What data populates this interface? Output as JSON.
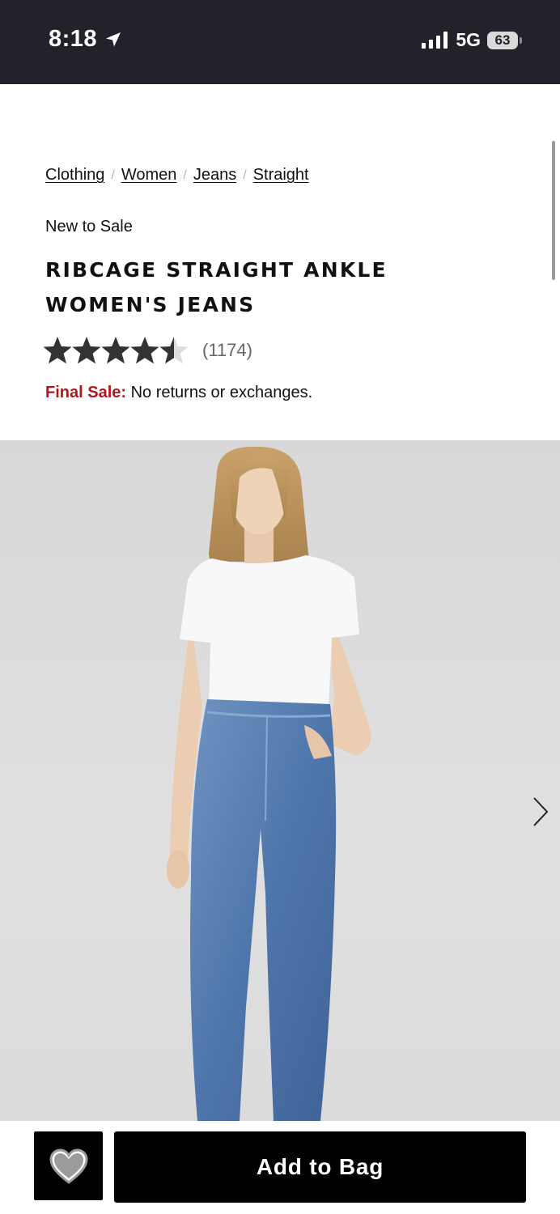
{
  "status_bar": {
    "time": "8:18",
    "network": "5G",
    "battery": "63"
  },
  "breadcrumb": [
    {
      "label": "Clothing"
    },
    {
      "label": "Women"
    },
    {
      "label": "Jeans"
    },
    {
      "label": "Straight"
    }
  ],
  "product": {
    "sale_tag": "New to Sale",
    "title": "RIBCAGE STRAIGHT ANKLE WOMEN'S JEANS",
    "rating": 4.5,
    "rating_max": 5,
    "review_count": "(1174)",
    "final_sale_label": "Final Sale:",
    "final_sale_text": "No returns or exchanges."
  },
  "icons": {
    "location": "location-arrow-icon",
    "signal": "cellular-signal-icon",
    "next": "chevron-right-icon",
    "wishlist": "heart-icon"
  },
  "actions": {
    "add_to_bag": "Add to Bag"
  },
  "colors": {
    "status_bar_bg": "#22232a",
    "sale_red": "#b3161e",
    "button_black": "#000000",
    "star_fill": "#333333",
    "star_empty": "#dcdcdc"
  }
}
